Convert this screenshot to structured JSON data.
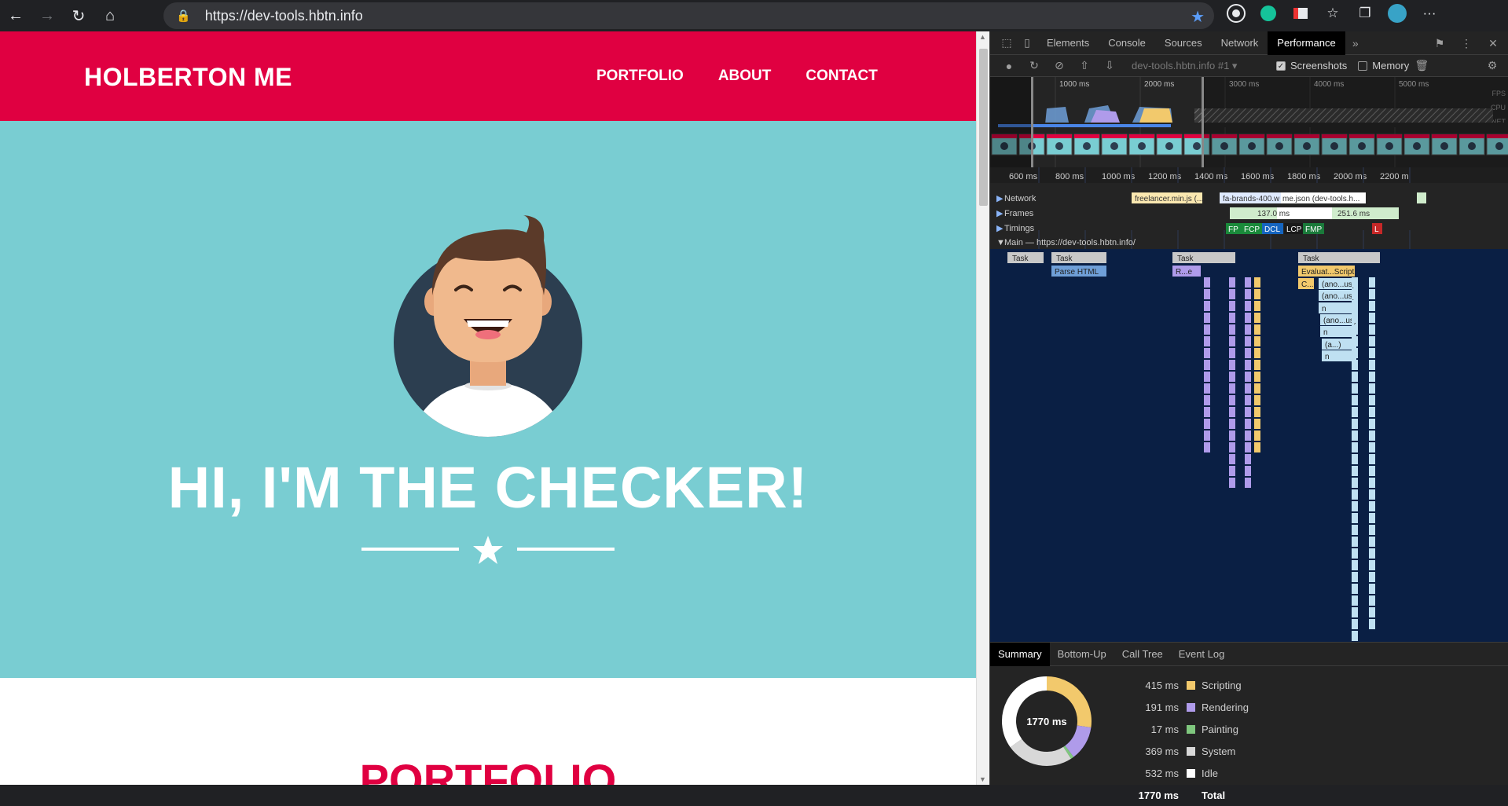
{
  "browser": {
    "url": "https://dev-tools.hbtn.info"
  },
  "site": {
    "brand": "HOLBERTON ME",
    "nav": [
      "PORTFOLIO",
      "ABOUT",
      "CONTACT"
    ],
    "hero_title": "HI, I'M THE CHECKER!",
    "section_heading": "PORTFOLIO",
    "colors": {
      "primary": "#e00041",
      "hero_bg": "#79cdd2"
    }
  },
  "devtools": {
    "tabs": [
      "Elements",
      "Console",
      "Sources",
      "Network",
      "Performance"
    ],
    "active_tab": "Performance",
    "toolbar": {
      "profile": "dev-tools.hbtn.info #1",
      "screenshots_label": "Screenshots",
      "screenshots_checked": true,
      "memory_label": "Memory",
      "memory_checked": false
    },
    "overview_ticks": [
      "1000 ms",
      "2000 ms",
      "3000 ms",
      "4000 ms",
      "5000 ms"
    ],
    "overview_labels": [
      "FPS",
      "CPU",
      "NET"
    ],
    "ruler_ticks": [
      "600 ms",
      "800 ms",
      "1000 ms",
      "1200 ms",
      "1400 ms",
      "1600 ms",
      "1800 ms",
      "2000 ms",
      "2200 m"
    ],
    "tracks": {
      "network_label": "Network",
      "network_items": [
        "freelancer.min.js (...",
        "fa-brands-400.w",
        "me.json (dev-tools.h..."
      ],
      "frames_label": "Frames",
      "frames_items": [
        "137.0 ms",
        "251.6 ms"
      ],
      "timings_label": "Timings",
      "timings_markers": [
        "FP",
        "FCP",
        "DCL",
        "LCP",
        "FMP",
        "L"
      ],
      "main_label": "Main — https://dev-tools.hbtn.info/"
    },
    "flame": {
      "tasks": [
        "Task",
        "Task",
        "Task",
        "Task"
      ],
      "calls": [
        "Parse HTML",
        "R...e",
        "Evaluat...Script",
        "C...",
        "(ano...us)",
        "(ano...us)",
        "n",
        "(ano...us)",
        "n",
        "(a...)",
        "n"
      ]
    },
    "summary": {
      "tabs": [
        "Summary",
        "Bottom-Up",
        "Call Tree",
        "Event Log"
      ],
      "active_tab": "Summary",
      "total_label": "1770 ms",
      "rows": [
        {
          "value": "415 ms",
          "name": "Scripting",
          "color": "#f2c96c",
          "ms": 415
        },
        {
          "value": "191 ms",
          "name": "Rendering",
          "color": "#af9bea",
          "ms": 191
        },
        {
          "value": "17 ms",
          "name": "Painting",
          "color": "#7fc77e",
          "ms": 17
        },
        {
          "value": "369 ms",
          "name": "System",
          "color": "#d8d8d8",
          "ms": 369
        },
        {
          "value": "532 ms",
          "name": "Idle",
          "color": "#ffffff",
          "ms": 532
        }
      ],
      "total_row": {
        "value": "1770 ms",
        "name": "Total"
      }
    }
  }
}
